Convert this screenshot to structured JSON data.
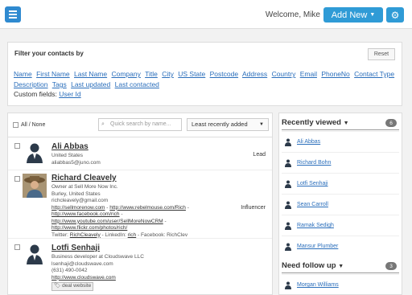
{
  "header": {
    "welcome": "Welcome, Mike",
    "add_new_label": "Add New",
    "menu_icon": "hamburger-menu-icon",
    "settings_icon": "gear-icon",
    "accent_color": "#2f9bd6"
  },
  "filter": {
    "title": "Filter your contacts by",
    "reset_label": "Reset",
    "fields": [
      "Name",
      "First Name",
      "Last Name",
      "Company",
      "Title",
      "City",
      "US State",
      "Postcode",
      "Address",
      "Country",
      "Email",
      "PhoneNo",
      "Contact Type",
      "Description",
      "Tags",
      "Last updated",
      "Last contacted"
    ],
    "custom_label": "Custom fields:",
    "custom_fields": [
      "User Id"
    ]
  },
  "list": {
    "all_none_label": "All / None",
    "search_placeholder": "Quick search by name...",
    "sort_value": "Least recently added",
    "contacts": [
      {
        "name": "Ali Abbas",
        "lines": [
          "United States",
          "aliabbas5@juno.com"
        ],
        "role": "Lead"
      },
      {
        "name": "Richard Cleavely",
        "lines": [
          "Owner at Sell More Now Inc.",
          "Burley, United States",
          "richcleavely@gmail.com"
        ],
        "links": [
          "http://sellmorenow.com",
          "http://www.rebelmouse.com/Rich",
          "http://www.facebook.com/rich",
          "http://www.youtube.com/user/SellMoreNowCRM",
          "http://www.flickr.com/photos/rich/"
        ],
        "social": {
          "twitter_label": "Twitter:",
          "twitter": "RichCleavely",
          "linkedin_label": "LinkedIn:",
          "linkedin": "rich",
          "facebook_label": "Facebook: RichClev"
        },
        "role": "Influencer"
      },
      {
        "name": "Lotfi Senhaji",
        "lines": [
          "Business developer at Cloudswave LLC",
          "lsenhaji@cloudswave.com",
          "(631) 490-0042"
        ],
        "link": "http://www.cloudswave.com",
        "tag": "deal website"
      }
    ]
  },
  "recently_viewed": {
    "title": "Recently viewed",
    "count": "6",
    "items": [
      "Ali Abbas",
      "Richard Bohn",
      "Lotfi Senhaji",
      "Sean Carroll",
      "Ramak Sedigh",
      "Mansur Plumber"
    ]
  },
  "follow_up": {
    "title": "Need follow up",
    "count": "3",
    "items": [
      "Morgan Williams"
    ]
  }
}
